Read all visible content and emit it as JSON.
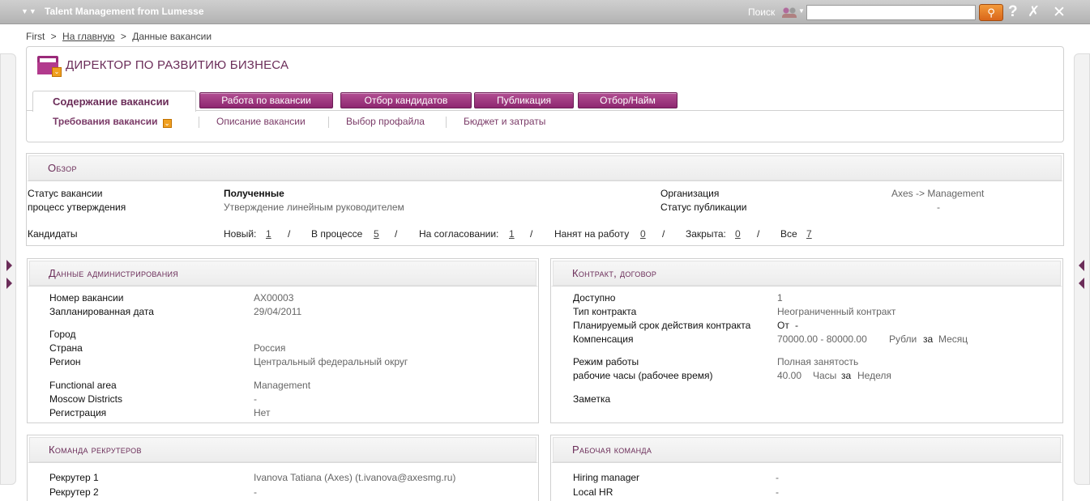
{
  "app": {
    "title": "Talent Management from Lumesse",
    "search_label": "Поиск",
    "search_value": ""
  },
  "breadcrumb": {
    "first": "First",
    "home": "На главную",
    "current": "Данные вакансии",
    "sep": ">"
  },
  "vacancy": {
    "title": "ДИРЕКТОР ПО РАЗВИТИЮ БИЗНЕСА"
  },
  "tabs": {
    "active": "Содержание вакансии",
    "items": [
      "Работа по вакансии",
      "Отбор кандидатов",
      "Публикация",
      "Отбор/Найм"
    ]
  },
  "subtabs": [
    "Требования вакансии",
    "Описание вакансии",
    "Выбор профайла",
    "Бюджет и затраты"
  ],
  "overview": {
    "title": "Обзор",
    "status_label": "Статус вакансии",
    "status_value": "Полученные",
    "process_label": "процесс утверждения",
    "process_value": "Утверждение линейным руководителем",
    "org_label": "Организация",
    "org_value": "Axes -> Management",
    "pub_label": "Статус публикации",
    "pub_value": "-",
    "candidates_label": "Кандидаты",
    "counts": [
      {
        "label": "Новый:",
        "value": "1"
      },
      {
        "label": "В процессе",
        "value": "5"
      },
      {
        "label": "На согласовании:",
        "value": "1"
      },
      {
        "label": "Нанят на работу",
        "value": "0"
      },
      {
        "label": "Закрыта:",
        "value": "0"
      },
      {
        "label": "Все",
        "value": "7"
      }
    ],
    "slash": "/"
  },
  "admin": {
    "title": "Данные администрирования",
    "rows": [
      {
        "label": "Номер вакансии",
        "value": "AX00003"
      },
      {
        "label": "Запланированная дата",
        "value": "29/04/2011"
      },
      {
        "label": "Город",
        "value": ""
      },
      {
        "label": "Страна",
        "value": "Россия"
      },
      {
        "label": "Регион",
        "value": "Центральный федеральный округ"
      },
      {
        "label": "Functional area",
        "value": "Management"
      },
      {
        "label": "Moscow Districts",
        "value": "-"
      },
      {
        "label": "Регистрация",
        "value": "Нет"
      }
    ]
  },
  "contract": {
    "title": "Контракт, договор",
    "available_label": "Доступно",
    "available_value": "1",
    "type_label": "Тип контракта",
    "type_value": "Неограниченный контракт",
    "term_label": "Планируемый срок действия контракта",
    "term_from": "От",
    "term_value": "-",
    "comp_label": "Компенсация",
    "comp_range": "70000.00  -  80000.00",
    "comp_currency": "Рубли",
    "comp_per": "за",
    "comp_period": "Месяц",
    "mode_label": "Режим работы",
    "mode_value": "Полная занятость",
    "hours_label": "рабочие часы (рабочее время)",
    "hours_value": "40.00",
    "hours_unit": "Часы",
    "hours_per": "за",
    "hours_period": "Неделя",
    "note_label": "Заметка"
  },
  "recruiters": {
    "title": "Команда рекрутеров",
    "r1_label": "Рекрутер 1",
    "r1_value": "Ivanova Tatiana (Axes)  (t.ivanova@axesmg.ru)",
    "r2_label": "Рекрутер 2",
    "r2_value": "-"
  },
  "workteam": {
    "title": "Рабочая команда",
    "hm_label": "Hiring manager",
    "hm_value": "-",
    "hr_label": "Local HR",
    "hr_value": "-"
  }
}
